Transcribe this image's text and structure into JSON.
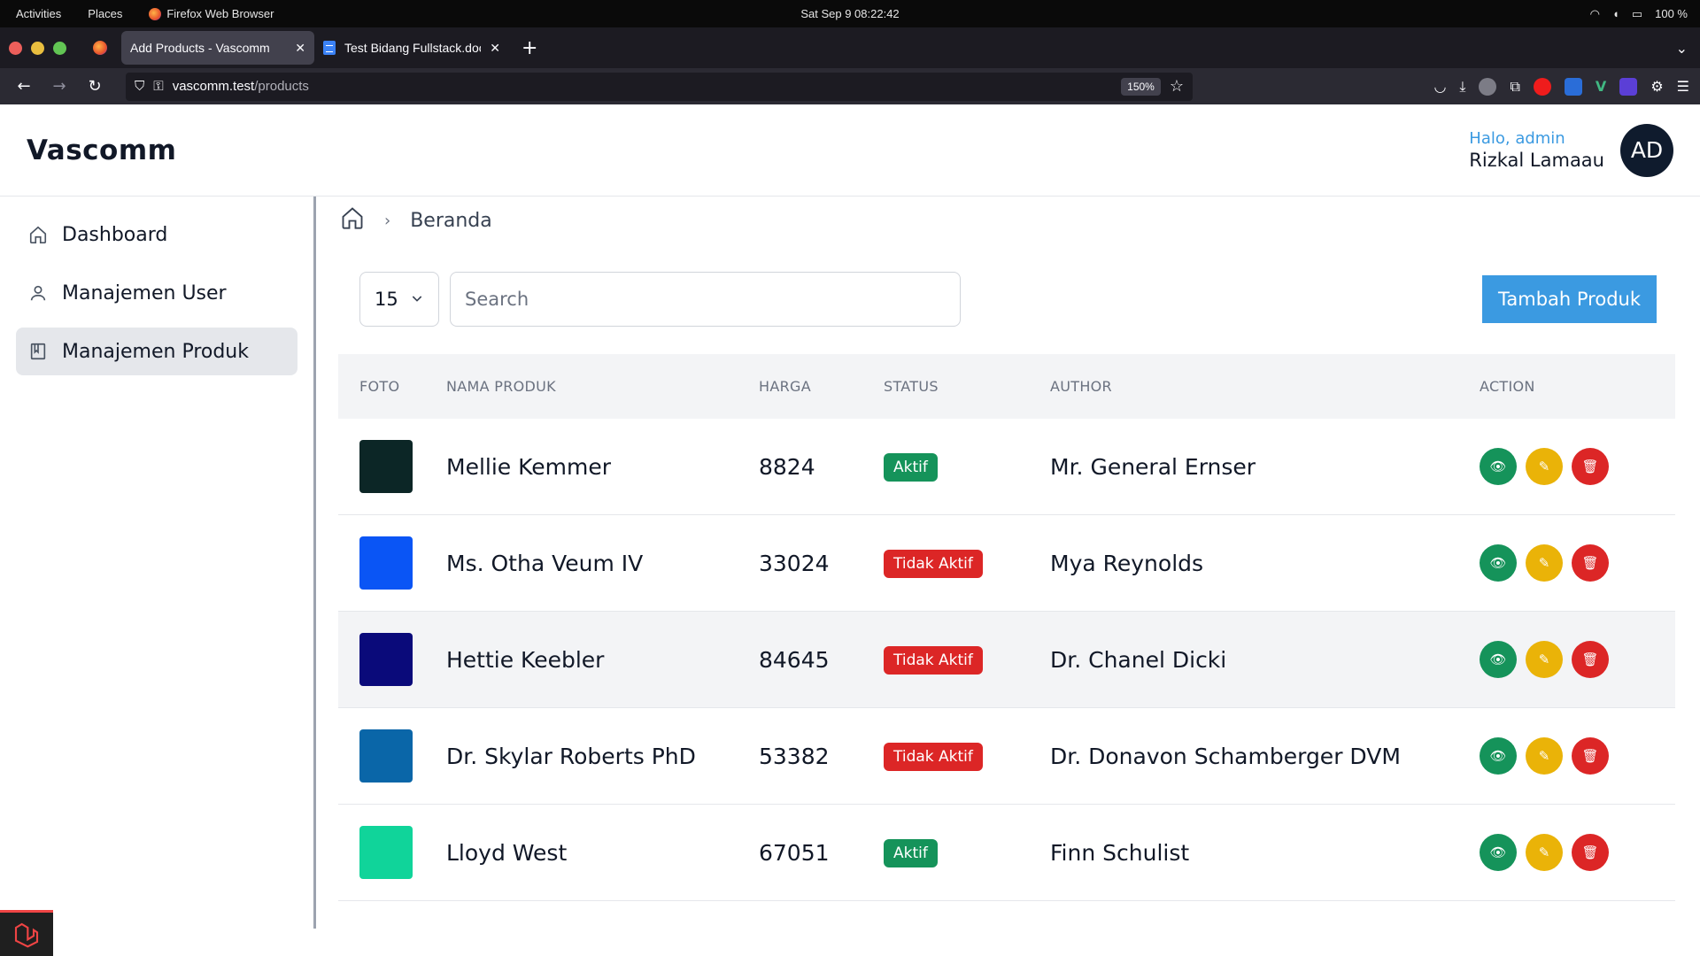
{
  "system_bar": {
    "activities": "Activities",
    "places": "Places",
    "app": "Firefox Web Browser",
    "clock": "Sat Sep 9  08:22:42",
    "battery": "100 %"
  },
  "browser": {
    "tabs": [
      {
        "label": "Add Products - Vascomm",
        "active": true
      },
      {
        "label": "Test Bidang Fullstack.docx",
        "active": false
      }
    ],
    "url_host": "vascomm.test",
    "url_path": "/products",
    "zoom": "150%"
  },
  "header": {
    "logo": "Vascomm",
    "greeting": "Halo, admin",
    "user_name": "Rizkal Lamaau",
    "avatar_initials": "AD"
  },
  "sidebar": {
    "items": [
      {
        "label": "Dashboard",
        "icon": "home-icon",
        "active": false
      },
      {
        "label": "Manajemen User",
        "icon": "user-icon",
        "active": false
      },
      {
        "label": "Manajemen Produk",
        "icon": "book-icon",
        "active": true
      }
    ]
  },
  "breadcrumb": {
    "current": "Beranda"
  },
  "toolbar": {
    "per_page": "15",
    "search_placeholder": "Search",
    "add_button": "Tambah Produk"
  },
  "table": {
    "headers": {
      "foto": "FOTO",
      "nama": "NAMA PRODUK",
      "harga": "HARGA",
      "status": "STATUS",
      "author": "AUTHOR",
      "action": "ACTION"
    },
    "rows": [
      {
        "nama": "Mellie Kemmer",
        "harga": "8824",
        "status": "Aktif",
        "author": "Mr. General Ernser",
        "thumb_color": "#0c2626",
        "status_color": "#15935a"
      },
      {
        "nama": "Ms. Otha Veum IV",
        "harga": "33024",
        "status": "Tidak Aktif",
        "author": "Mya Reynolds",
        "thumb_color": "#0a55f5",
        "status_color": "#dc2626"
      },
      {
        "nama": "Hettie Keebler",
        "harga": "84645",
        "status": "Tidak Aktif",
        "author": "Dr. Chanel Dicki",
        "thumb_color": "#0a0a7a",
        "status_color": "#dc2626"
      },
      {
        "nama": "Dr. Skylar Roberts PhD",
        "harga": "53382",
        "status": "Tidak Aktif",
        "author": "Dr. Donavon Schamberger DVM",
        "thumb_color": "#0a66a8",
        "status_color": "#dc2626"
      },
      {
        "nama": "Lloyd West",
        "harga": "67051",
        "status": "Aktif",
        "author": "Finn Schulist",
        "thumb_color": "#10d49a",
        "status_color": "#15935a"
      }
    ]
  },
  "colors": {
    "accent": "#3b9ae1",
    "view": "#15935a",
    "edit": "#eab308",
    "delete": "#dc2626"
  }
}
